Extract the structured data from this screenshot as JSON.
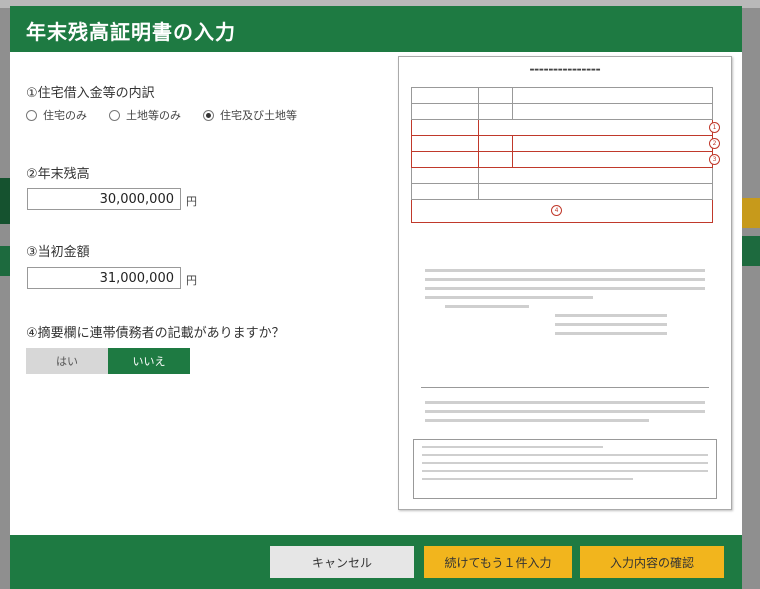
{
  "modal": {
    "title": "年末残高証明書の入力"
  },
  "questions": {
    "q1": {
      "label": "①住宅借入金等の内訳",
      "options": [
        {
          "label": "住宅のみ",
          "checked": false
        },
        {
          "label": "土地等のみ",
          "checked": false
        },
        {
          "label": "住宅及び土地等",
          "checked": true
        }
      ]
    },
    "q2": {
      "label": "②年末残高",
      "value": "30,000,000",
      "unit": "円"
    },
    "q3": {
      "label": "③当初金額",
      "value": "31,000,000",
      "unit": "円"
    },
    "q4": {
      "label": "④摘要欄に連帯債務者の記載がありますか？",
      "yes_label": "はい",
      "no_label": "いいえ",
      "selected": "no"
    }
  },
  "footer": {
    "cancel_label": "キャンセル",
    "continue_label": "続けてもう１件入力",
    "confirm_label": "入力内容の確認"
  },
  "colors": {
    "header_green": "#1e7a42",
    "button_yellow": "#f2b51d",
    "highlight_red": "#c0392b"
  }
}
